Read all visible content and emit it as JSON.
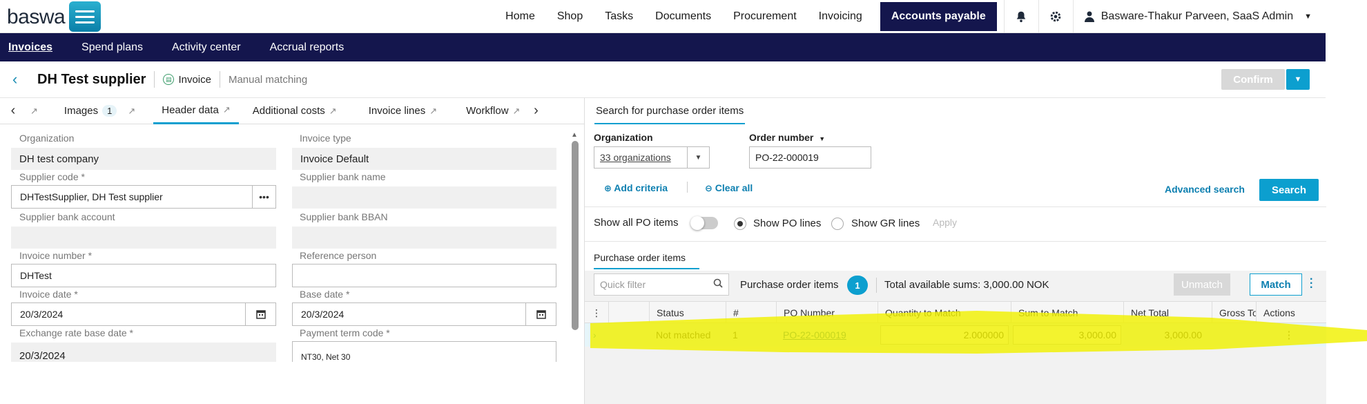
{
  "topnav": {
    "logo": "baswa",
    "items": [
      "Home",
      "Shop",
      "Tasks",
      "Documents",
      "Procurement",
      "Invoicing",
      "Accounts payable"
    ],
    "active": "Accounts payable",
    "user": "Basware-Thakur Parveen, SaaS Admin"
  },
  "subnav": {
    "items": [
      "Invoices",
      "Spend plans",
      "Activity center",
      "Accrual reports"
    ],
    "active": "Invoices"
  },
  "header": {
    "title": "DH Test supplier",
    "doc_type": "Invoice",
    "mode": "Manual matching",
    "confirm_label": "Confirm"
  },
  "tabs": {
    "images_label": "Images",
    "images_count": "1",
    "header_data": "Header data",
    "additional_costs": "Additional costs",
    "invoice_lines": "Invoice lines",
    "workflow": "Workflow"
  },
  "form": {
    "organization": {
      "label": "Organization",
      "value": "DH test company"
    },
    "invoice_type": {
      "label": "Invoice type",
      "value": "Invoice Default"
    },
    "supplier_code": {
      "label": "Supplier code *",
      "value": "DHTestSupplier, DH Test supplier"
    },
    "supplier_bank_name": {
      "label": "Supplier bank name",
      "value": ""
    },
    "supplier_bank_account": {
      "label": "Supplier bank account",
      "value": ""
    },
    "supplier_bank_bban": {
      "label": "Supplier bank BBAN",
      "value": ""
    },
    "invoice_number": {
      "label": "Invoice number *",
      "value": "DHTest"
    },
    "reference_person": {
      "label": "Reference person",
      "value": ""
    },
    "invoice_date": {
      "label": "Invoice date *",
      "value": "20/3/2024"
    },
    "base_date": {
      "label": "Base date *",
      "value": "20/3/2024"
    },
    "exchange_rate_base_date": {
      "label": "Exchange rate base date *",
      "value": "20/3/2024"
    },
    "payment_term_code": {
      "label": "Payment term code *",
      "value": "NT30, Net 30"
    }
  },
  "search": {
    "tab_label": "Search for purchase order items",
    "organization_label": "Organization",
    "organization_value": "33 organizations",
    "order_number_label": "Order number",
    "order_number_value": "PO-22-000019",
    "add_criteria": "Add criteria",
    "clear_all": "Clear all",
    "advanced_search": "Advanced search",
    "search_button": "Search",
    "show_all_po_items": "Show all PO items",
    "show_po_lines": "Show PO lines",
    "show_gr_lines": "Show GR lines",
    "apply": "Apply"
  },
  "po_items": {
    "tab_label": "Purchase order items",
    "quick_filter_placeholder": "Quick filter",
    "count_label": "Purchase order items",
    "count": "1",
    "total_sums": "Total available sums: 3,000.00  NOK",
    "unmatch": "Unmatch",
    "match": "Match",
    "columns": [
      "Status",
      "#",
      "PO Number",
      "Quantity to Match",
      "Sum to Match",
      "Net Total",
      "Gross To",
      "Actions"
    ],
    "rows": [
      {
        "status": "Not matched",
        "num": "1",
        "po_number": "PO-22-000019",
        "quantity": "2.000000",
        "sum": "3,000.00",
        "net_total": "3,000.00",
        "gross_total": ""
      }
    ]
  },
  "colors": {
    "nav_dark": "#14164d",
    "accent": "#0c9fcf",
    "highlight": "#f0f000"
  }
}
